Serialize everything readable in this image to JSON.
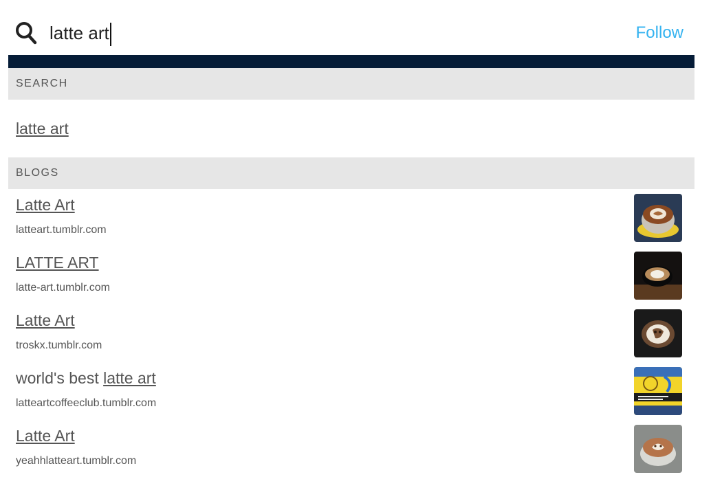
{
  "search": {
    "query": "latte art",
    "follow_label": "Follow"
  },
  "sections": {
    "search_header": "SEARCH",
    "blogs_header": "BLOGS"
  },
  "suggestion": "latte art",
  "blogs": [
    {
      "title_prefix": "",
      "title_link": "Latte Art",
      "url": "latteart.tumblr.com",
      "thumb": "latte-cup-saucer"
    },
    {
      "title_prefix": "",
      "title_link": "LATTE ART",
      "url": "latte-art.tumblr.com",
      "thumb": "latte-dark-cup"
    },
    {
      "title_prefix": "",
      "title_link": "Latte Art",
      "url": "troskx.tumblr.com",
      "thumb": "latte-cat-art"
    },
    {
      "title_prefix": "world's best ",
      "title_link": "latte art",
      "url": "latteartcoffeeclub.tumblr.com",
      "thumb": "coffee-club-logo"
    },
    {
      "title_prefix": "",
      "title_link": "Latte Art",
      "url": "yeahhlatteart.tumblr.com",
      "thumb": "latte-bear-art"
    }
  ],
  "colors": {
    "accent": "#35b3f0",
    "navy": "#051c37",
    "header_bg": "#e6e6e6"
  }
}
